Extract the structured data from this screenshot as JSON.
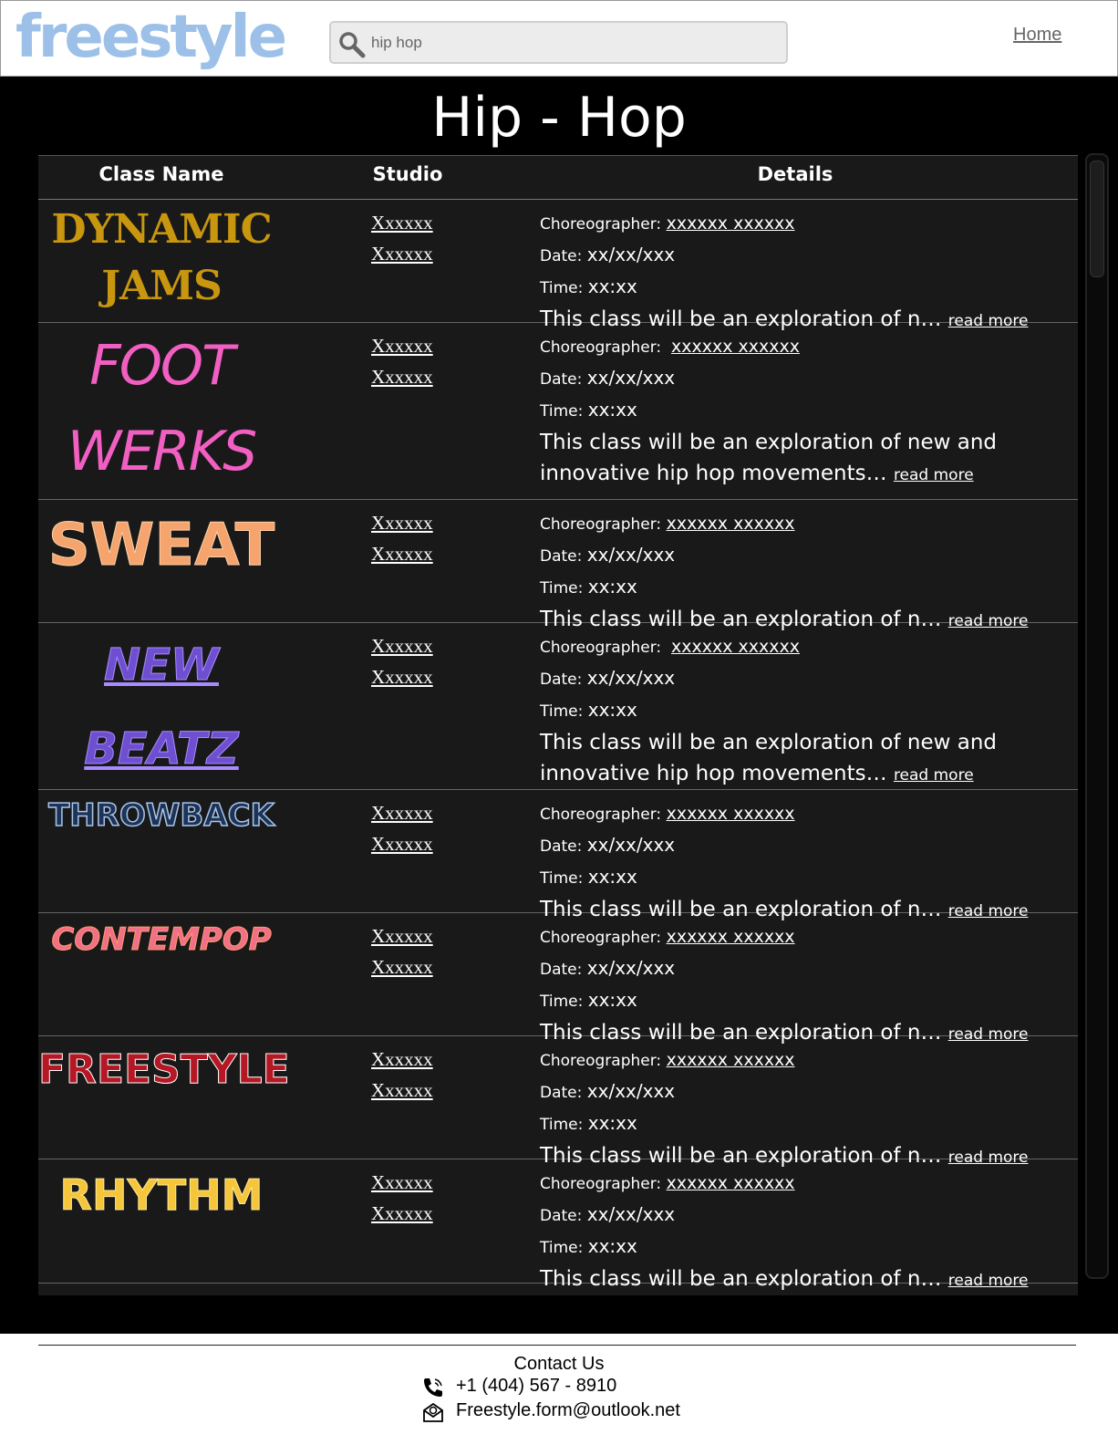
{
  "header": {
    "logo": "freestyle",
    "search": {
      "value": "hip hop",
      "placeholder": "hip hop"
    },
    "home_label": "Home"
  },
  "page": {
    "title": "Hip - Hop"
  },
  "table": {
    "columns": [
      "Class Name",
      "Studio",
      "Details"
    ],
    "rows": [
      {
        "name_lines": [
          "DYNAMIC",
          "JAMS"
        ],
        "studios": [
          "Xxxxxx",
          "Xxxxxx"
        ],
        "choreographer_label": "Choreographer:",
        "choreographer": "xxxxxx xxxxxx",
        "date_label": "Date:",
        "date": "xx/xx/xxx",
        "time_label": "Time:",
        "time": "xx:xx",
        "description": "This class will be an exploration of n…",
        "read_more": "read more"
      },
      {
        "name_lines": [
          "FOOT",
          "WERKS"
        ],
        "studios": [
          "Xxxxxx",
          "Xxxxxx"
        ],
        "choreographer_label": "Choreographer:",
        "choreographer": "xxxxxx xxxxxx",
        "date_label": "Date:",
        "date": "xx/xx/xxx",
        "time_label": "Time:",
        "time": "xx:xx",
        "description_lines": [
          "This class will be an exploration of new and",
          "innovative hip hop movements…"
        ],
        "read_more": "read more"
      },
      {
        "name_lines": [
          "SWEAT"
        ],
        "studios": [
          "Xxxxxx",
          "Xxxxxx"
        ],
        "choreographer_label": "Choreographer:",
        "choreographer": "xxxxxx xxxxxx",
        "date_label": "Date:",
        "date": "xx/xx/xxx",
        "time_label": "Time:",
        "time": "xx:xx",
        "description": "This class will be an exploration of n…",
        "read_more": "read more"
      },
      {
        "name_lines": [
          "NEW",
          "BEATZ"
        ],
        "studios": [
          "Xxxxxx",
          "Xxxxxx"
        ],
        "choreographer_label": "Choreographer:",
        "choreographer": "xxxxxx xxxxxx",
        "date_label": "Date:",
        "date": "xx/xx/xxx",
        "time_label": "Time:",
        "time": "xx:xx",
        "description_lines": [
          "This class will be an exploration of new and",
          "innovative hip hop movements…"
        ],
        "read_more": "read more"
      },
      {
        "name_lines": [
          "THROWBACK"
        ],
        "studios": [
          "Xxxxxx",
          "Xxxxxx"
        ],
        "choreographer_label": "Choreographer:",
        "choreographer": "xxxxxx xxxxxx",
        "date_label": "Date:",
        "date": "xx/xx/xxx",
        "time_label": "Time:",
        "time": "xx:xx",
        "description": "This class will be an exploration of n…",
        "read_more": "read more"
      },
      {
        "name_lines": [
          "CONTEMPOP"
        ],
        "studios": [
          "Xxxxxx",
          "Xxxxxx"
        ],
        "choreographer_label": "Choreographer:",
        "choreographer": "xxxxxx xxxxxx",
        "date_label": "Date:",
        "date": "xx/xx/xxx",
        "time_label": "Time:",
        "time": "xx:xx",
        "description": "This class will be an exploration of n…",
        "read_more": "read more"
      },
      {
        "name_lines": [
          "FREESTYLE"
        ],
        "studios": [
          "Xxxxxx",
          "Xxxxxx"
        ],
        "choreographer_label": "Choreographer:",
        "choreographer": "xxxxxx xxxxxx",
        "date_label": "Date:",
        "date": "xx/xx/xxx",
        "time_label": "Time:",
        "time": "xx:xx",
        "description": "This class will be an exploration of n…",
        "read_more": "read more"
      },
      {
        "name_lines": [
          "RHYTHM"
        ],
        "studios": [
          "Xxxxxx",
          "Xxxxxx"
        ],
        "choreographer_label": "Choreographer:",
        "choreographer": "xxxxxx xxxxxx",
        "date_label": "Date:",
        "date": "xx/xx/xxx",
        "time_label": "Time:",
        "time": "xx:xx",
        "description": "This class will be an exploration of n…",
        "read_more": "read more"
      }
    ]
  },
  "footer": {
    "contact_title": "Contact Us",
    "phone": "+1 (404) 567 - 8910",
    "email": "Freestyle.form@outlook.net"
  },
  "icons": {
    "search": "search-icon",
    "phone": "phone-icon",
    "email": "email-icon"
  },
  "colors": {
    "background": "#000000",
    "table": "#191919",
    "logo": "#9cc0e8"
  }
}
